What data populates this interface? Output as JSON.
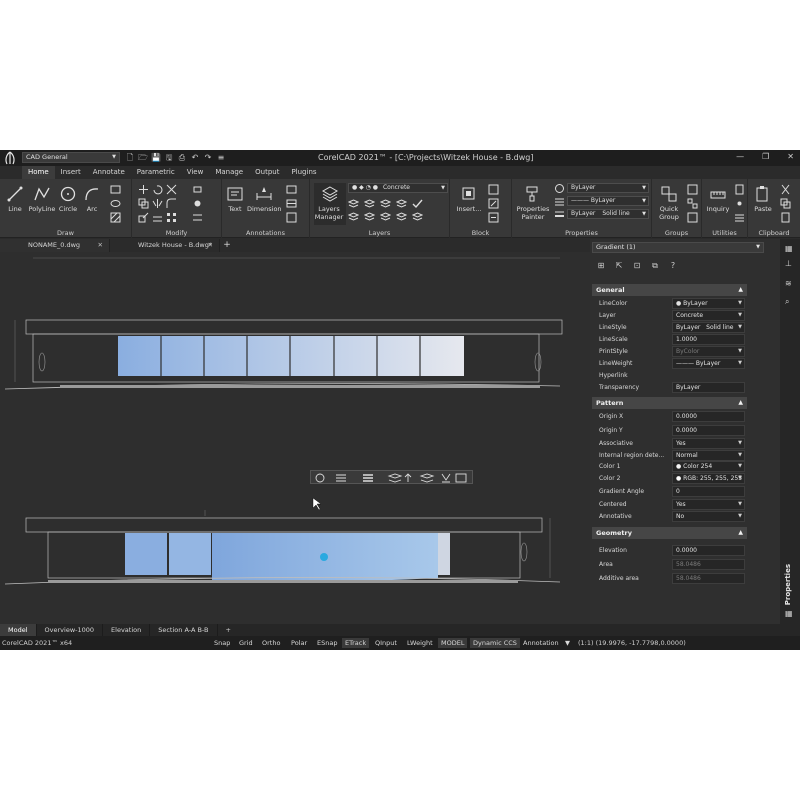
{
  "titlebar": {
    "workspace": "CAD General",
    "title": "CorelCAD 2021™ - [C:\\Projects\\Witzek House - B.dwg]",
    "window_controls": [
      "minimize-icon",
      "restore-icon",
      "close-icon"
    ]
  },
  "ribbon_tabs": [
    "Home",
    "Insert",
    "Annotate",
    "Parametric",
    "View",
    "Manage",
    "Output",
    "Plugins"
  ],
  "ribbon": {
    "draw": {
      "label": "Draw",
      "tools": [
        "Line",
        "PolyLine",
        "Circle",
        "Arc"
      ]
    },
    "modify": {
      "label": "Modify"
    },
    "annotations": {
      "label": "Annotations",
      "tools": [
        "Text",
        "Dimension"
      ]
    },
    "layers": {
      "label": "Layers",
      "manager": "Layers Manager",
      "current_layer": "Concrete"
    },
    "block": {
      "label": "Block",
      "insert": "Insert..."
    },
    "properties": {
      "label": "Properties",
      "painter": "Properties Painter",
      "color": "ByLayer",
      "linetype": "ByLayer",
      "lineweight_a": "ByLayer",
      "lineweight_b": "Solid line"
    },
    "groups": {
      "label": "Groups",
      "quick_group": "Quick Group"
    },
    "utilities": {
      "label": "Utilities",
      "inquiry": "Inquiry"
    },
    "clipboard": {
      "label": "Clipboard",
      "paste": "Paste"
    }
  },
  "doc_tabs": [
    {
      "label": "NONAME_0.dwg",
      "active": false
    },
    {
      "label": "Witzek House - B.dwg*",
      "active": true
    }
  ],
  "properties_panel": {
    "selector": "Gradient (1)",
    "general": {
      "title": "General",
      "rows": [
        {
          "key": "LineColor",
          "value": "ByLayer"
        },
        {
          "key": "Layer",
          "value": "Concrete"
        },
        {
          "key": "LineStyle",
          "value": "ByLayer",
          "value2": "Solid line"
        },
        {
          "key": "LineScale",
          "value": "1.0000"
        },
        {
          "key": "PrintStyle",
          "value": "ByColor"
        },
        {
          "key": "LineWeight",
          "value": "——— ByLayer"
        },
        {
          "key": "Hyperlink",
          "value": ""
        },
        {
          "key": "Transparency",
          "value": "ByLayer"
        }
      ]
    },
    "pattern": {
      "title": "Pattern",
      "rows": [
        {
          "key": "Origin X",
          "value": "0.0000"
        },
        {
          "key": "Origin Y",
          "value": "0.0000"
        },
        {
          "key": "Associative",
          "value": "Yes"
        },
        {
          "key": "Internal region dete...",
          "value": "Normal"
        },
        {
          "key": "Color 1",
          "value": "Color 254"
        },
        {
          "key": "Color 2",
          "value": "RGB: 255, 255, 255"
        },
        {
          "key": "Gradient Angle",
          "value": "0"
        },
        {
          "key": "Centered",
          "value": "Yes"
        },
        {
          "key": "Annotative",
          "value": "No"
        }
      ]
    },
    "geometry": {
      "title": "Geometry",
      "rows": [
        {
          "key": "Elevation",
          "value": "0.0000"
        },
        {
          "key": "Area",
          "value": "58.0486"
        },
        {
          "key": "Additive area",
          "value": "58.0486"
        }
      ]
    },
    "side_label": "Properties"
  },
  "layout_tabs": [
    "Model",
    "Overview-1000",
    "Elevation",
    "Section A-A B-B"
  ],
  "status": {
    "app": "CorelCAD 2021™ x64",
    "toggles": [
      "Snap",
      "Grid",
      "Ortho",
      "Polar",
      "ESnap",
      "ETrack",
      "QInput",
      "LWeight",
      "MODEL",
      "Dynamic CCS",
      "Annotation"
    ],
    "scale": "(1:1)",
    "coords": "(19.9976, -17.7798,0.0000)"
  },
  "colors": {
    "accent_blue": "#8fb3e0",
    "grip": "#2aa9e0",
    "bg": "#2b2b2b"
  }
}
